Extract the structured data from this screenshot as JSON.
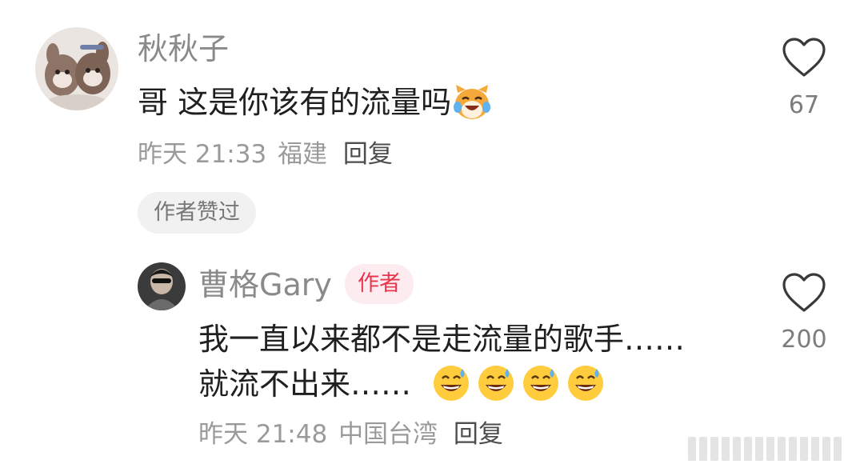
{
  "comment": {
    "author": "秋秋子",
    "text": "哥 这是你该有的流量吗",
    "text_emoji": "cat-laughing-tears-emoji",
    "time": "昨天 21:33",
    "location": "福建",
    "reply_label": "回复",
    "liked_by_author_label": "作者赞过",
    "like_count": "67"
  },
  "reply": {
    "author": "曹格Gary",
    "author_badge": "作者",
    "line1": "我一直以来都不是走流量的歌手……",
    "line2": "就流不出来……",
    "line2_emojis": [
      "grinning-sweat-emoji",
      "grinning-sweat-emoji",
      "grinning-sweat-emoji",
      "grinning-sweat-emoji"
    ],
    "time": "昨天 21:48",
    "location": "中国台湾",
    "reply_label": "回复",
    "like_count": "200"
  },
  "colors": {
    "name": "#8a8a8a",
    "text": "#1f1f1f",
    "meta": "#9a9a9a",
    "badge_bg": "#fdecef",
    "badge_text": "#e8364f",
    "chip_bg": "#f1f1f1"
  }
}
